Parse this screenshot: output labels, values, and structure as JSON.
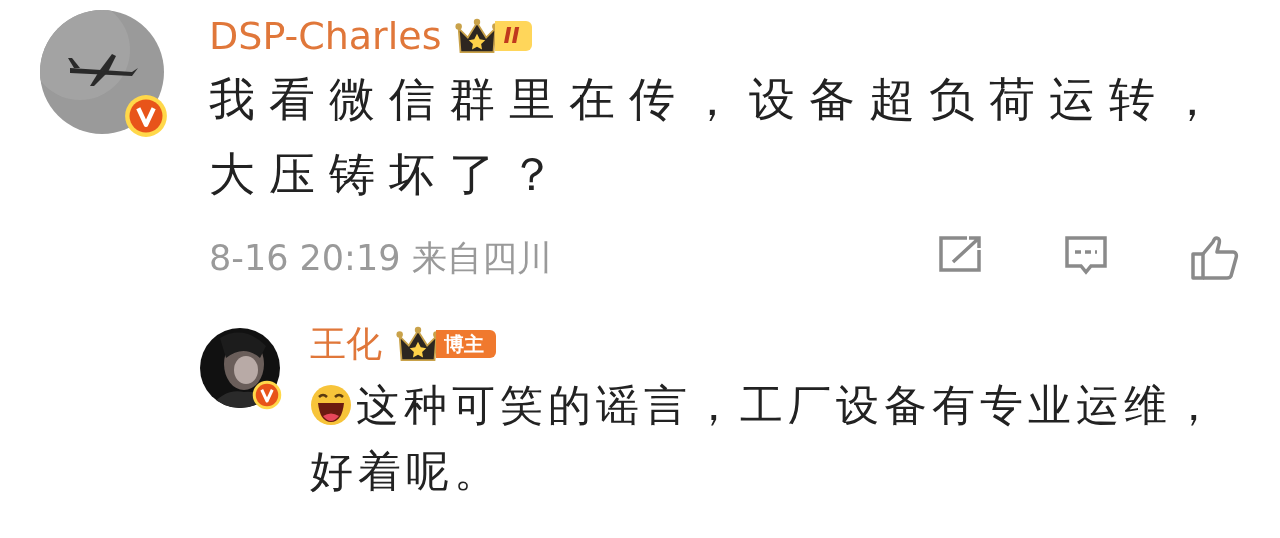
{
  "comment": {
    "author": {
      "name": "DSP-Charles",
      "verified": true,
      "level_badge": "II"
    },
    "text": "我看微信群里在传，设备超负荷运转，大压铸坏了？",
    "meta": "8-16 20:19 来自四川"
  },
  "reply": {
    "author": {
      "name": "王化",
      "verified": true,
      "role_badge": "博主"
    },
    "text_lines": [
      "这种可笑的谣言，工厂设备有专业运维，",
      "好着呢。"
    ]
  }
}
